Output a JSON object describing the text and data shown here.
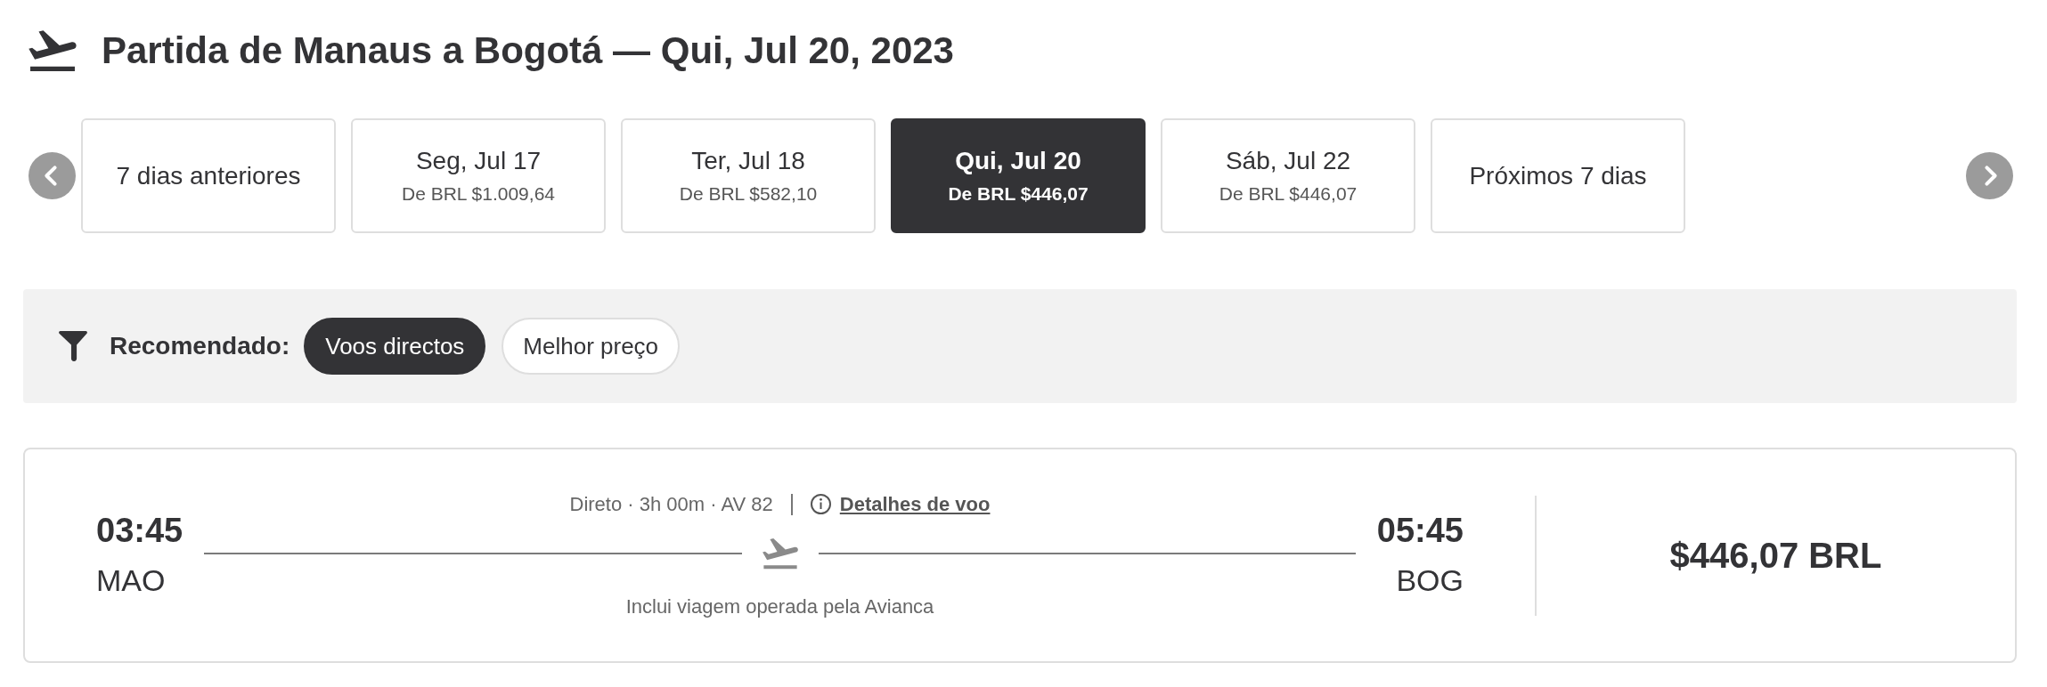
{
  "header": {
    "title": "Partida de Manaus a Bogotá — Qui, Jul 20, 2023"
  },
  "date_tabs": {
    "items": [
      {
        "kind": "range",
        "label": "7 dias anteriores",
        "selected": false
      },
      {
        "kind": "day",
        "label": "Seg, Jul 17",
        "price": "De BRL $1.009,64",
        "selected": false
      },
      {
        "kind": "day",
        "label": "Ter, Jul 18",
        "price": "De BRL $582,10",
        "selected": false
      },
      {
        "kind": "day",
        "label": "Qui, Jul 20",
        "price": "De BRL $446,07",
        "selected": true
      },
      {
        "kind": "day",
        "label": "Sáb, Jul 22",
        "price": "De BRL $446,07",
        "selected": false
      },
      {
        "kind": "range",
        "label": "Próximos 7 dias",
        "selected": false
      }
    ]
  },
  "filter_bar": {
    "label": "Recomendado:",
    "chips": [
      {
        "label": "Voos directos",
        "selected": true
      },
      {
        "label": "Melhor preço",
        "selected": false
      }
    ]
  },
  "flights": [
    {
      "departure": {
        "time": "03:45",
        "airport": "MAO"
      },
      "summary": "Direto · 3h 00m · AV 82",
      "details_link": "Detalhes de voo",
      "operator_note": "Inclui viagem operada pela Avianca",
      "arrival": {
        "time": "05:45",
        "airport": "BOG"
      },
      "price": "$446,07 BRL"
    }
  ]
}
